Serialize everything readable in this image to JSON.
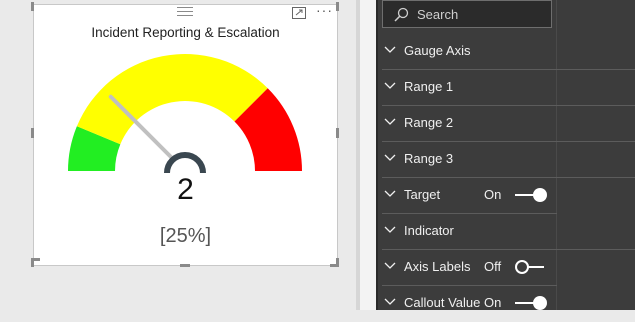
{
  "visual": {
    "title": "Incident Reporting & Escalation",
    "value": "2",
    "percent": "[25%]",
    "gauge": {
      "min": 0,
      "max": 8,
      "value": 2,
      "ranges": [
        {
          "from": 0,
          "to": 1,
          "color": "#22ee22"
        },
        {
          "from": 1,
          "to": 6,
          "color": "#ffff00"
        },
        {
          "from": 6,
          "to": 8,
          "color": "#ff0000"
        }
      ],
      "needle_color": "#c0c0c0",
      "hub_color": "#3a4750"
    },
    "header_icons": [
      "drag-handle-icon",
      "focus-mode-icon",
      "more-options-icon"
    ]
  },
  "format_pane": {
    "search": {
      "placeholder": "Search"
    },
    "sections": [
      {
        "label": "Gauge Axis"
      },
      {
        "label": "Range 1"
      },
      {
        "label": "Range 2"
      },
      {
        "label": "Range 3"
      },
      {
        "label": "Target",
        "state": "On",
        "toggle": true
      },
      {
        "label": "Indicator"
      },
      {
        "label": "Axis Labels",
        "state": "Off",
        "toggle": false
      },
      {
        "label": "Callout Value",
        "state": "On",
        "toggle": true
      }
    ]
  },
  "colors": {
    "pane_bg": "#3c3c3c",
    "text": "#f0f0f0"
  }
}
